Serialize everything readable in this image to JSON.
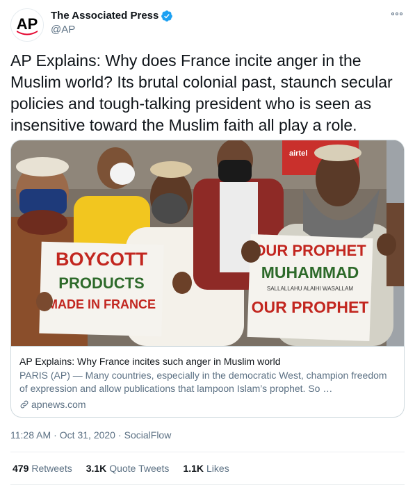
{
  "account": {
    "display_name": "The Associated Press",
    "handle": "@AP",
    "avatar_text": "AP",
    "verified": true
  },
  "tweet": {
    "text": "AP Explains: Why does France incite anger in the Muslim world? Its brutal colonial past, staunch secular policies and tough-talking president who is seen as insensitive toward the Muslim faith all play a role."
  },
  "card": {
    "photo_signs": {
      "left": [
        "BOYCOTT",
        "PRODUCTS",
        "MADE IN FRANCE"
      ],
      "right": [
        "OUR PROPHET",
        "MUHAMMAD",
        "SALLALLAHU ALAIHI WASALLAM",
        "OUR PROPHET"
      ],
      "store_sign": "airtel"
    },
    "title": "AP Explains: Why France incites such anger in Muslim world",
    "description": "PARIS (AP) — Many countries, especially in the democratic West, champion freedom of expression and allow publications that lampoon Islam’s prophet. So …",
    "domain": "apnews.com"
  },
  "meta": {
    "time": "11:28 AM",
    "date": "Oct 31, 2020",
    "source": "SocialFlow"
  },
  "stats": {
    "retweets_count": "479",
    "retweets_label": "Retweets",
    "quotes_count": "3.1K",
    "quotes_label": "Quote Tweets",
    "likes_count": "1.1K",
    "likes_label": "Likes"
  },
  "colors": {
    "ap_red": "#e4002b",
    "verified_blue": "#1da1f2",
    "text_primary": "#0f1419",
    "text_secondary": "#5b7083"
  },
  "icons": {
    "verified": "verified-badge-icon",
    "more": "more-options-icon",
    "link": "link-icon"
  }
}
